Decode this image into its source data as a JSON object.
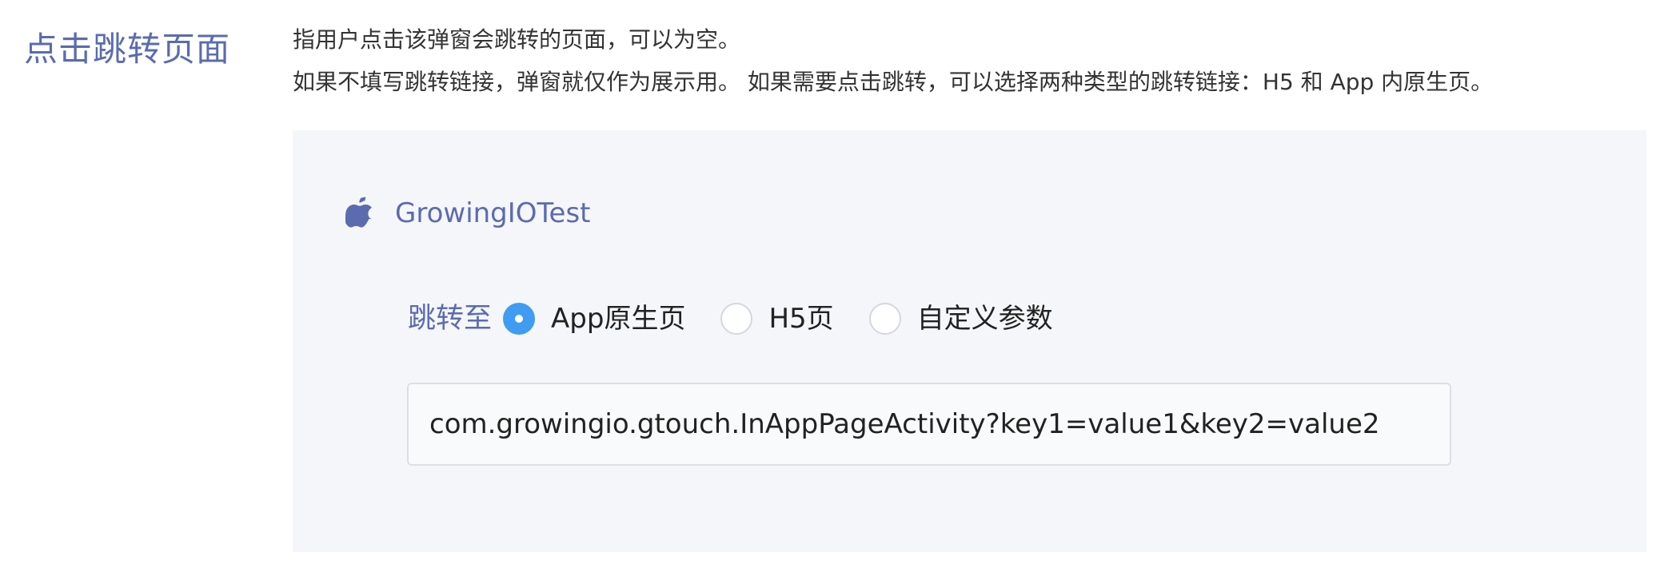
{
  "section": {
    "title": "点击跳转页面",
    "description_line1": "指用户点击该弹窗会跳转的页面，可以为空。",
    "description_line2": "如果不填写跳转链接，弹窗就仅作为展示用。 如果需要点击跳转，可以选择两种类型的跳转链接：H5 和 App 内原生页。"
  },
  "panel": {
    "app": {
      "icon": "apple-icon",
      "name": "GrowingIOTest"
    },
    "jump": {
      "label": "跳转至",
      "options": [
        {
          "label": "App原生页",
          "checked": true
        },
        {
          "label": "H5页",
          "checked": false
        },
        {
          "label": "自定义参数",
          "checked": false
        }
      ]
    },
    "url_input": {
      "value": "com.growingio.gtouch.InAppPageActivity?key1=value1&key2=value2"
    }
  },
  "colors": {
    "accent": "#5b6bb0",
    "radio_checked": "#3f9cf2",
    "panel_bg": "#f5f6f9"
  }
}
